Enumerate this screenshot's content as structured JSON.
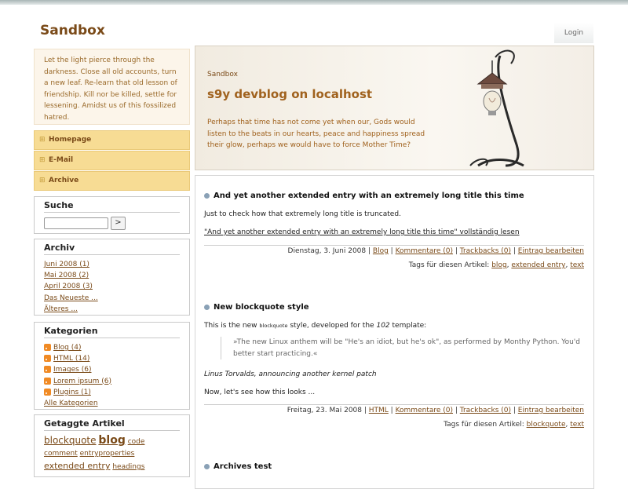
{
  "site": {
    "title": "Sandbox",
    "login_label": "Login"
  },
  "sidebar": {
    "tagline": "Let the light pierce through the darkness. Close all old accounts, turn a new leaf. Re-learn that old lesson of friendship. Kill nor be killed, settle for lessening. Amidst us of this fossilized hatred.",
    "nav": [
      {
        "label": "Homepage"
      },
      {
        "label": "E-Mail"
      },
      {
        "label": "Archive"
      }
    ],
    "search": {
      "title": "Suche",
      "button_label": ">",
      "value": ""
    },
    "archive": {
      "title": "Archiv",
      "items": [
        "Juni 2008 (1)",
        "Mai 2008 (2)",
        "April 2008 (3)",
        "Das Neueste ...",
        "Älteres ..."
      ]
    },
    "categories": {
      "title": "Kategorien",
      "items": [
        "Blog (4)",
        "HTML (14)",
        "Images (6)",
        "Lorem ipsum (6)",
        "Plugins (1)"
      ],
      "all_label": "Alle Kategorien"
    },
    "tags": {
      "title": "Getaggte Artikel",
      "items": [
        "blockquote",
        "blog",
        "code",
        "comment",
        "entryproperties",
        "extended entry",
        "headings"
      ]
    }
  },
  "header": {
    "small": "Sandbox",
    "title": "s9y devblog on localhost",
    "description": "Perhaps that time has not come yet when our, Gods would listen to the beats in our hearts, peace and happiness spread their glow, perhaps we would have to force Mother Time?"
  },
  "entries": [
    {
      "title": "And yet another extended entry with an extremely long title this time",
      "body": "Just to check how that extremely long title is truncated.",
      "read_more": "\"And yet another extended entry with an extremely long title this time\" vollständig lesen",
      "date": "Dienstag, 3. Juni 2008",
      "category": "Blog",
      "comments": "Kommentare (0)",
      "trackbacks": "Trackbacks (0)",
      "edit": "Eintrag bearbeiten",
      "tags_label": "Tags für diesen Artikel:",
      "tags": [
        "blog",
        "extended entry",
        "text"
      ]
    },
    {
      "title": "New blockquote style",
      "body_pre": "This is the new",
      "body_code": "blockquote",
      "body_mid": "style, developed for the",
      "body_em": "102",
      "body_post": "template:",
      "quote": "»The new Linux anthem will be \"He's an idiot, but he's ok\", as performed by Monthy Python. You'd better start practicing.«",
      "attribution": "Linus Torvalds, announcing another kernel patch",
      "closing": "Now, let's see how this looks ...",
      "date": "Freitag, 23. Mai 2008",
      "category": "HTML",
      "comments": "Kommentare (0)",
      "trackbacks": "Trackbacks (0)",
      "edit": "Eintrag bearbeiten",
      "tags_label": "Tags für diesen Artikel:",
      "tags": [
        "blockquote",
        "text"
      ]
    },
    {
      "title": "Archives test"
    }
  ],
  "colors": {
    "accent": "#7a4a18",
    "nav_bg": "#f7dc94",
    "header_text": "#a0621e"
  },
  "icons": {
    "rss": "rss-feed-icon",
    "lamp": "lamp-illustration",
    "bullet": "entry-bullet-icon",
    "expand": "plus-icon"
  }
}
